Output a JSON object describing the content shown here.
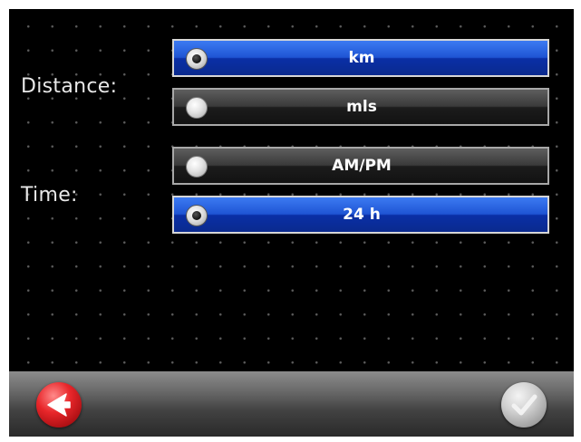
{
  "settings": {
    "distance": {
      "label": "Distance:",
      "options": [
        {
          "label": "km",
          "selected": true
        },
        {
          "label": "mls",
          "selected": false
        }
      ]
    },
    "time": {
      "label": "Time:",
      "options": [
        {
          "label": "AM/PM",
          "selected": false
        },
        {
          "label": "24 h",
          "selected": true
        }
      ]
    }
  },
  "footer": {
    "back_icon": "back-arrow-icon",
    "confirm_icon": "checkmark-icon"
  },
  "colors": {
    "selected": "#1f55d4",
    "unselected": "#2a2a2a",
    "back_button": "#e8262a",
    "confirm_button": "#bdbdbd"
  }
}
